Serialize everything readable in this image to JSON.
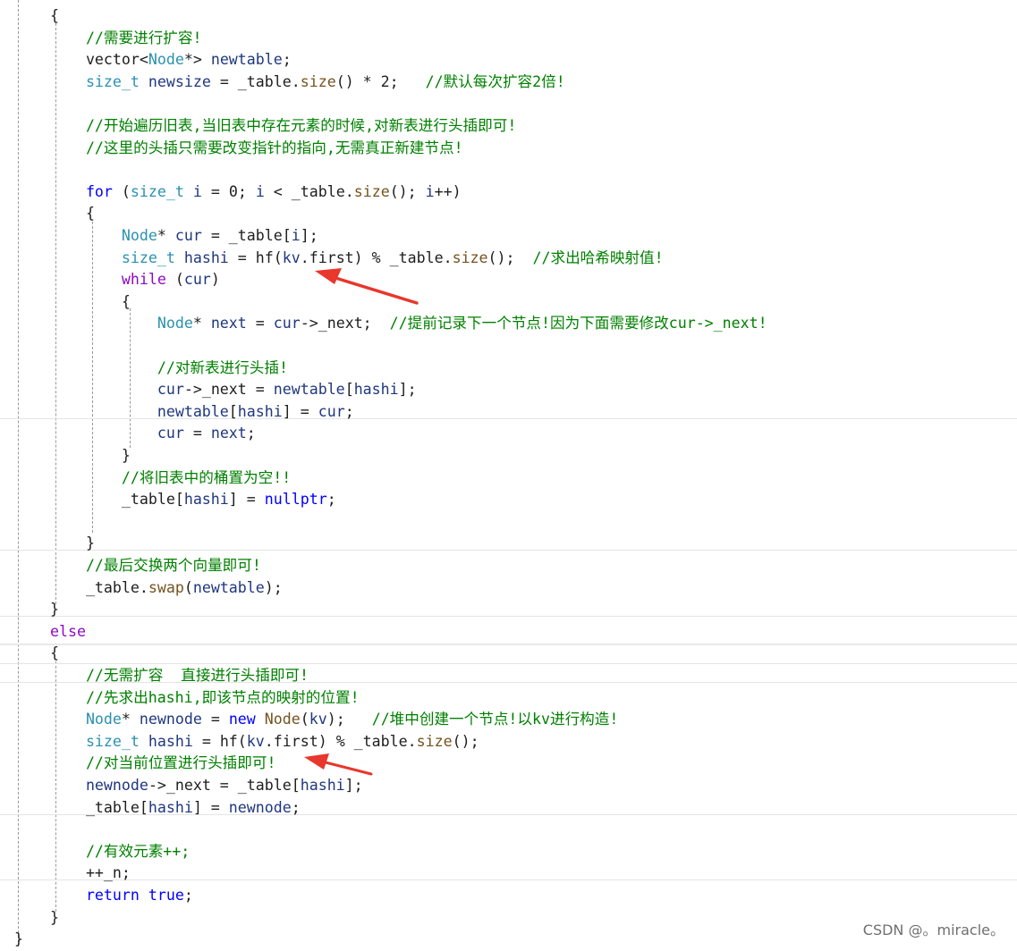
{
  "theme": {
    "keyword": "#0000ff",
    "control": "#8f08c4",
    "type": "#2b91af",
    "function": "#74531f",
    "variable": "#1f377f",
    "comment": "#008000",
    "plain": "#1e1e1e",
    "arrow": "#e8372c"
  },
  "code": {
    "lines": [
      {
        "indent": 0,
        "tokens": [
          {
            "k": "pl",
            "t": "    "
          },
          {
            "k": "pl",
            "t": "{"
          }
        ]
      },
      {
        "indent": 0,
        "tokens": [
          {
            "k": "pl",
            "t": "        "
          },
          {
            "k": "cm",
            "t": "//需要进行扩容!"
          }
        ]
      },
      {
        "indent": 0,
        "tokens": [
          {
            "k": "pl",
            "t": "        "
          },
          {
            "k": "pl",
            "t": "vector<"
          },
          {
            "k": "ty",
            "t": "Node"
          },
          {
            "k": "pl",
            "t": "*> "
          },
          {
            "k": "var",
            "t": "newtable"
          },
          {
            "k": "pl",
            "t": ";"
          }
        ]
      },
      {
        "indent": 0,
        "tokens": [
          {
            "k": "pl",
            "t": "        "
          },
          {
            "k": "ty",
            "t": "size_t"
          },
          {
            "k": "pl",
            "t": " "
          },
          {
            "k": "var",
            "t": "newsize"
          },
          {
            "k": "pl",
            "t": " = _table."
          },
          {
            "k": "fn",
            "t": "size"
          },
          {
            "k": "pl",
            "t": "() * 2;   "
          },
          {
            "k": "cm",
            "t": "//默认每次扩容2倍!"
          }
        ]
      },
      {
        "indent": 0,
        "tokens": []
      },
      {
        "indent": 0,
        "tokens": [
          {
            "k": "pl",
            "t": "        "
          },
          {
            "k": "cm",
            "t": "//开始遍历旧表,当旧表中存在元素的时候,对新表进行头插即可!"
          }
        ]
      },
      {
        "indent": 0,
        "tokens": [
          {
            "k": "pl",
            "t": "        "
          },
          {
            "k": "cm",
            "t": "//这里的头插只需要改变指针的指向,无需真正新建节点!"
          }
        ]
      },
      {
        "indent": 0,
        "tokens": []
      },
      {
        "indent": 0,
        "tokens": [
          {
            "k": "pl",
            "t": "        "
          },
          {
            "k": "kw",
            "t": "for"
          },
          {
            "k": "pl",
            "t": " ("
          },
          {
            "k": "ty",
            "t": "size_t"
          },
          {
            "k": "pl",
            "t": " "
          },
          {
            "k": "var",
            "t": "i"
          },
          {
            "k": "pl",
            "t": " = 0; "
          },
          {
            "k": "var",
            "t": "i"
          },
          {
            "k": "pl",
            "t": " < _table."
          },
          {
            "k": "fn",
            "t": "size"
          },
          {
            "k": "pl",
            "t": "(); "
          },
          {
            "k": "var",
            "t": "i"
          },
          {
            "k": "pl",
            "t": "++)"
          }
        ]
      },
      {
        "indent": 0,
        "tokens": [
          {
            "k": "pl",
            "t": "        "
          },
          {
            "k": "pl",
            "t": "{"
          }
        ]
      },
      {
        "indent": 0,
        "tokens": [
          {
            "k": "pl",
            "t": "            "
          },
          {
            "k": "ty",
            "t": "Node"
          },
          {
            "k": "pl",
            "t": "* "
          },
          {
            "k": "var",
            "t": "cur"
          },
          {
            "k": "pl",
            "t": " = _table["
          },
          {
            "k": "var",
            "t": "i"
          },
          {
            "k": "pl",
            "t": "];"
          }
        ]
      },
      {
        "indent": 0,
        "tokens": [
          {
            "k": "pl",
            "t": "            "
          },
          {
            "k": "ty",
            "t": "size_t"
          },
          {
            "k": "pl",
            "t": " "
          },
          {
            "k": "var",
            "t": "hashi"
          },
          {
            "k": "pl",
            "t": " = hf("
          },
          {
            "k": "var",
            "t": "kv"
          },
          {
            "k": "pl",
            "t": ".first) % _table."
          },
          {
            "k": "fn",
            "t": "size"
          },
          {
            "k": "pl",
            "t": "();  "
          },
          {
            "k": "cm",
            "t": "//求出哈希映射值!"
          }
        ]
      },
      {
        "indent": 0,
        "tokens": [
          {
            "k": "pl",
            "t": "            "
          },
          {
            "k": "ctl",
            "t": "while"
          },
          {
            "k": "pl",
            "t": " ("
          },
          {
            "k": "var",
            "t": "cur"
          },
          {
            "k": "pl",
            "t": ")"
          }
        ]
      },
      {
        "indent": 0,
        "tokens": [
          {
            "k": "pl",
            "t": "            "
          },
          {
            "k": "pl",
            "t": "{"
          }
        ]
      },
      {
        "indent": 0,
        "tokens": [
          {
            "k": "pl",
            "t": "                "
          },
          {
            "k": "ty",
            "t": "Node"
          },
          {
            "k": "pl",
            "t": "* "
          },
          {
            "k": "var",
            "t": "next"
          },
          {
            "k": "pl",
            "t": " = "
          },
          {
            "k": "var",
            "t": "cur"
          },
          {
            "k": "pl",
            "t": "->_next;  "
          },
          {
            "k": "cm",
            "t": "//提前记录下一个节点!因为下面需要修改cur->_next!"
          }
        ]
      },
      {
        "indent": 0,
        "tokens": []
      },
      {
        "indent": 0,
        "tokens": [
          {
            "k": "pl",
            "t": "                "
          },
          {
            "k": "cm",
            "t": "//对新表进行头插!"
          }
        ]
      },
      {
        "indent": 0,
        "tokens": [
          {
            "k": "pl",
            "t": "                "
          },
          {
            "k": "var",
            "t": "cur"
          },
          {
            "k": "pl",
            "t": "->_next = "
          },
          {
            "k": "var",
            "t": "newtable"
          },
          {
            "k": "pl",
            "t": "["
          },
          {
            "k": "var",
            "t": "hashi"
          },
          {
            "k": "pl",
            "t": "];"
          }
        ]
      },
      {
        "indent": 0,
        "tokens": [
          {
            "k": "pl",
            "t": "                "
          },
          {
            "k": "var",
            "t": "newtable"
          },
          {
            "k": "pl",
            "t": "["
          },
          {
            "k": "var",
            "t": "hashi"
          },
          {
            "k": "pl",
            "t": "] = "
          },
          {
            "k": "var",
            "t": "cur"
          },
          {
            "k": "pl",
            "t": ";"
          }
        ]
      },
      {
        "indent": 0,
        "tokens": [
          {
            "k": "pl",
            "t": "                "
          },
          {
            "k": "var",
            "t": "cur"
          },
          {
            "k": "pl",
            "t": " = "
          },
          {
            "k": "var",
            "t": "next"
          },
          {
            "k": "pl",
            "t": ";"
          }
        ]
      },
      {
        "indent": 0,
        "tokens": [
          {
            "k": "pl",
            "t": "            "
          },
          {
            "k": "pl",
            "t": "}"
          }
        ]
      },
      {
        "indent": 0,
        "tokens": [
          {
            "k": "pl",
            "t": "            "
          },
          {
            "k": "cm",
            "t": "//将旧表中的桶置为空!!"
          }
        ]
      },
      {
        "indent": 0,
        "tokens": [
          {
            "k": "pl",
            "t": "            "
          },
          {
            "k": "pl",
            "t": "_table["
          },
          {
            "k": "var",
            "t": "hashi"
          },
          {
            "k": "pl",
            "t": "] = "
          },
          {
            "k": "kw",
            "t": "nullptr"
          },
          {
            "k": "pl",
            "t": ";"
          }
        ]
      },
      {
        "indent": 0,
        "tokens": []
      },
      {
        "indent": 0,
        "tokens": [
          {
            "k": "pl",
            "t": "        "
          },
          {
            "k": "pl",
            "t": "}"
          }
        ]
      },
      {
        "indent": 0,
        "tokens": [
          {
            "k": "pl",
            "t": "        "
          },
          {
            "k": "cm",
            "t": "//最后交换两个向量即可!"
          }
        ]
      },
      {
        "indent": 0,
        "tokens": [
          {
            "k": "pl",
            "t": "        "
          },
          {
            "k": "pl",
            "t": "_table."
          },
          {
            "k": "fn",
            "t": "swap"
          },
          {
            "k": "pl",
            "t": "("
          },
          {
            "k": "var",
            "t": "newtable"
          },
          {
            "k": "pl",
            "t": ");"
          }
        ]
      },
      {
        "indent": 0,
        "tokens": [
          {
            "k": "pl",
            "t": "    "
          },
          {
            "k": "pl",
            "t": "}"
          }
        ]
      },
      {
        "indent": 0,
        "tokens": [
          {
            "k": "pl",
            "t": "    "
          },
          {
            "k": "ctl",
            "t": "else"
          }
        ]
      },
      {
        "indent": 0,
        "tokens": [
          {
            "k": "pl",
            "t": "    "
          },
          {
            "k": "pl",
            "t": "{"
          }
        ]
      },
      {
        "indent": 0,
        "tokens": [
          {
            "k": "pl",
            "t": "        "
          },
          {
            "k": "cm",
            "t": "//无需扩容  直接进行头插即可!"
          }
        ]
      },
      {
        "indent": 0,
        "tokens": [
          {
            "k": "pl",
            "t": "        "
          },
          {
            "k": "cm",
            "t": "//先求出hashi,即该节点的映射的位置!"
          }
        ]
      },
      {
        "indent": 0,
        "tokens": [
          {
            "k": "pl",
            "t": "        "
          },
          {
            "k": "ty",
            "t": "Node"
          },
          {
            "k": "pl",
            "t": "* "
          },
          {
            "k": "var",
            "t": "newnode"
          },
          {
            "k": "pl",
            "t": " = "
          },
          {
            "k": "kw",
            "t": "new"
          },
          {
            "k": "pl",
            "t": " "
          },
          {
            "k": "fn",
            "t": "Node"
          },
          {
            "k": "pl",
            "t": "("
          },
          {
            "k": "var",
            "t": "kv"
          },
          {
            "k": "pl",
            "t": ");   "
          },
          {
            "k": "cm",
            "t": "//堆中创建一个节点!以kv进行构造!"
          }
        ]
      },
      {
        "indent": 0,
        "tokens": [
          {
            "k": "pl",
            "t": "        "
          },
          {
            "k": "ty",
            "t": "size_t"
          },
          {
            "k": "pl",
            "t": " "
          },
          {
            "k": "var",
            "t": "hashi"
          },
          {
            "k": "pl",
            "t": " = hf("
          },
          {
            "k": "var",
            "t": "kv"
          },
          {
            "k": "pl",
            "t": ".first) % _table."
          },
          {
            "k": "fn",
            "t": "size"
          },
          {
            "k": "pl",
            "t": "();"
          }
        ]
      },
      {
        "indent": 0,
        "tokens": [
          {
            "k": "pl",
            "t": "        "
          },
          {
            "k": "cm",
            "t": "//对当前位置进行头插即可!"
          }
        ]
      },
      {
        "indent": 0,
        "tokens": [
          {
            "k": "pl",
            "t": "        "
          },
          {
            "k": "var",
            "t": "newnode"
          },
          {
            "k": "pl",
            "t": "->_next = _table["
          },
          {
            "k": "var",
            "t": "hashi"
          },
          {
            "k": "pl",
            "t": "];"
          }
        ]
      },
      {
        "indent": 0,
        "tokens": [
          {
            "k": "pl",
            "t": "        "
          },
          {
            "k": "pl",
            "t": "_table["
          },
          {
            "k": "var",
            "t": "hashi"
          },
          {
            "k": "pl",
            "t": "] = "
          },
          {
            "k": "var",
            "t": "newnode"
          },
          {
            "k": "pl",
            "t": ";"
          }
        ]
      },
      {
        "indent": 0,
        "tokens": []
      },
      {
        "indent": 0,
        "tokens": [
          {
            "k": "pl",
            "t": "        "
          },
          {
            "k": "cm",
            "t": "//有效元素++;"
          }
        ]
      },
      {
        "indent": 0,
        "tokens": [
          {
            "k": "pl",
            "t": "        "
          },
          {
            "k": "pl",
            "t": "++_n;"
          }
        ]
      },
      {
        "indent": 0,
        "tokens": [
          {
            "k": "pl",
            "t": "        "
          },
          {
            "k": "kw",
            "t": "return"
          },
          {
            "k": "pl",
            "t": " "
          },
          {
            "k": "kw",
            "t": "true"
          },
          {
            "k": "pl",
            "t": ";"
          }
        ]
      },
      {
        "indent": 0,
        "tokens": [
          {
            "k": "pl",
            "t": "    "
          },
          {
            "k": "pl",
            "t": "}"
          }
        ]
      },
      {
        "indent": 0,
        "tokens": [
          {
            "k": "pl",
            "t": "}"
          }
        ]
      }
    ]
  },
  "annotations": [
    {
      "name": "red-arrow-1",
      "icon": "arrow-icon"
    },
    {
      "name": "red-arrow-2",
      "icon": "arrow-icon"
    }
  ],
  "watermark": {
    "text": "CSDN @。miracle。"
  }
}
